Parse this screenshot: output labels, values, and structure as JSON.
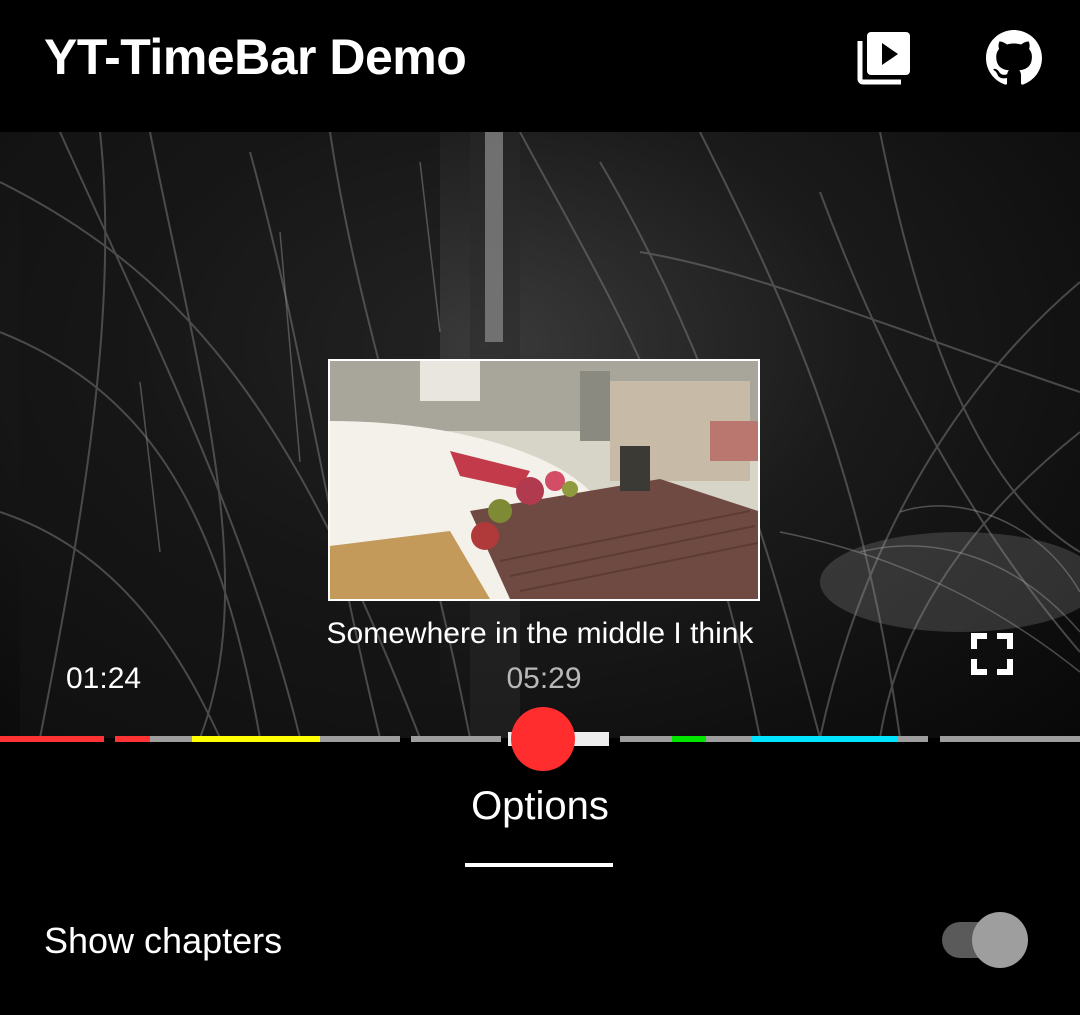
{
  "app": {
    "title": "YT-TimeBar Demo",
    "actions": [
      {
        "name": "playlist-icon"
      },
      {
        "name": "github-icon"
      }
    ]
  },
  "player": {
    "current_time": "01:24",
    "seek_time": "05:29",
    "preview_caption": "Somewhere in the middle I think",
    "playhead_fraction": 0.5,
    "colors": {
      "played": "#ff3333",
      "unplayed": "#9e9e9e",
      "buffered": "#eeeeee",
      "chapter_yellow": "#ffff00",
      "chapter_green": "#00e600",
      "chapter_cyan": "#00e5ff",
      "thumb": "#ff2d2d"
    }
  },
  "tabs": [
    {
      "label": "Options",
      "selected": true
    }
  ],
  "settings": [
    {
      "label": "Show chapters",
      "enabled": false
    }
  ]
}
